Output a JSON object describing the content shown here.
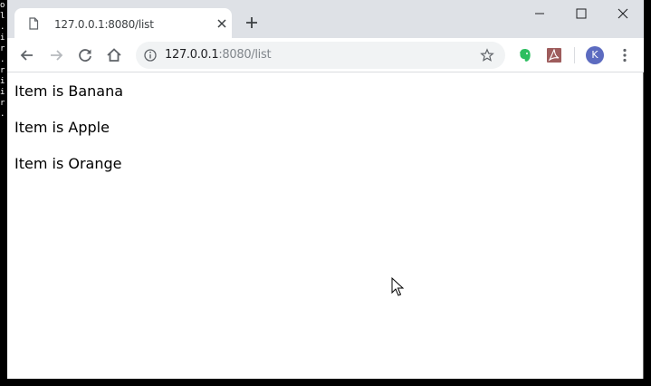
{
  "terminal": {
    "chars": [
      "o",
      "l",
      ".",
      "i",
      "r",
      "",
      ".",
      "r",
      "i",
      "",
      "i",
      "r",
      "."
    ]
  },
  "tab": {
    "title": "127.0.0.1:8080/list",
    "favicon": "page-icon"
  },
  "window_controls": [
    "minimize-icon",
    "maximize-icon",
    "close-icon"
  ],
  "omnibox": {
    "host": "127.0.0.1",
    "path": ":8080/list"
  },
  "profile": {
    "initial": "K",
    "color": "#5c6bc0"
  },
  "colors": {
    "tabstrip": "#dee1e6",
    "omnibox": "#f1f3f4",
    "evernote": "#2dbe60",
    "pdf": "#9e5c5c"
  },
  "page": {
    "items": [
      "Item is Banana",
      "Item is Apple",
      "Item is Orange"
    ]
  }
}
